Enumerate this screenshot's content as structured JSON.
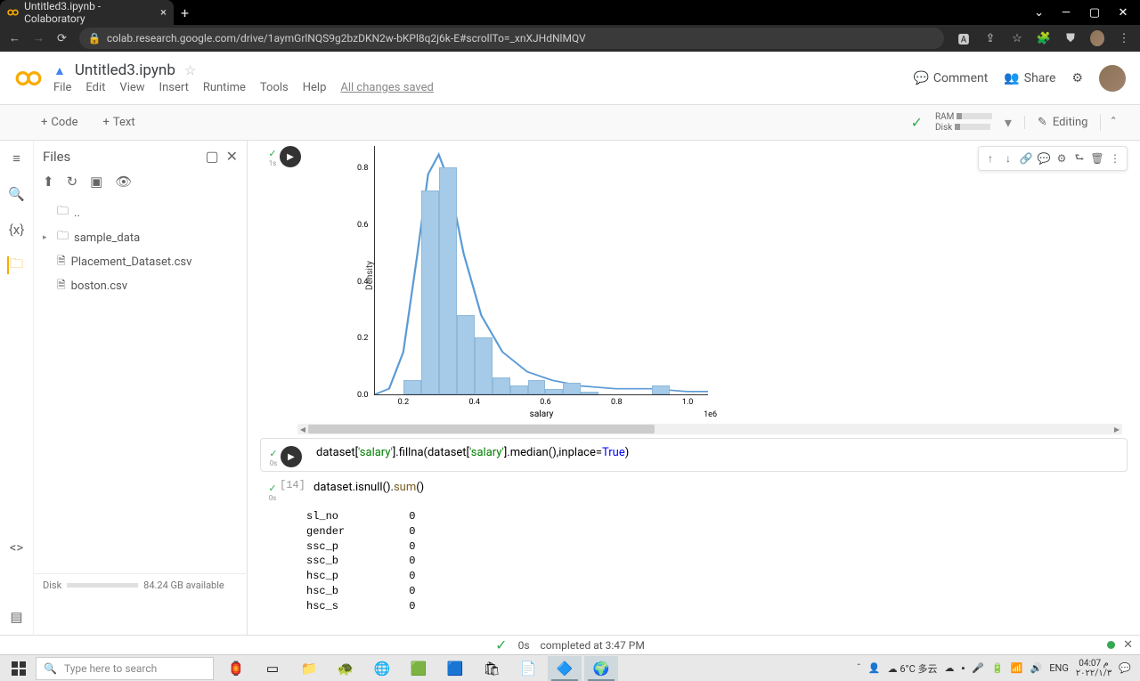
{
  "browser": {
    "tab_title": "Untitled3.ipynb - Colaboratory",
    "url": "colab.research.google.com/drive/1aymGrlNQS9g2bzDKN2w-bKPl8q2j6k-E#scrollTo=_xnXJHdNlMQV"
  },
  "colab": {
    "title": "Untitled3.ipynb",
    "menu": [
      "File",
      "Edit",
      "View",
      "Insert",
      "Runtime",
      "Tools",
      "Help"
    ],
    "saved_text": "All changes saved",
    "comment": "Comment",
    "share": "Share"
  },
  "toolbar": {
    "code": "Code",
    "text": "Text",
    "ram": "RAM",
    "disk": "Disk",
    "editing": "Editing"
  },
  "files": {
    "title": "Files",
    "dotdot": "..",
    "sample_data": "sample_data",
    "f1": "Placement_Dataset.csv",
    "f2": "boston.csv",
    "disk_label": "Disk",
    "disk_avail": "84.24 GB available"
  },
  "cells": {
    "c1_time": "1s",
    "c2_code_parts": {
      "p1": "dataset[",
      "p2": "'salary'",
      "p3": "].fillna(dataset[",
      "p4": "'salary'",
      "p5": "].median(),inplace=",
      "p6": "True",
      "p7": ")"
    },
    "c2_time": "0s",
    "c3_prompt": "[14]",
    "c3_code_parts": {
      "p1": "dataset.isnull().",
      "p2": "sum",
      "p3": "()"
    },
    "c3_time": "0s",
    "c3_output": "sl_no           0\ngender          0\nssc_p           0\nssc_b           0\nhsc_p           0\nhsc_b           0\nhsc_s           0"
  },
  "chart_data": {
    "type": "hist_kde",
    "xlabel": "salary",
    "ylabel": "Density",
    "sci": "1e6",
    "yticks": [
      0.0,
      0.2,
      0.4,
      0.6,
      0.8
    ],
    "xticks": [
      0.2,
      0.4,
      0.6,
      0.8,
      1.0
    ],
    "xlim": [
      0.12,
      1.06
    ],
    "ylim": [
      0.0,
      0.88
    ],
    "bars": [
      {
        "x": 0.2,
        "w": 0.05,
        "h": 0.05
      },
      {
        "x": 0.25,
        "w": 0.05,
        "h": 0.72
      },
      {
        "x": 0.3,
        "w": 0.05,
        "h": 0.8
      },
      {
        "x": 0.35,
        "w": 0.05,
        "h": 0.28
      },
      {
        "x": 0.4,
        "w": 0.05,
        "h": 0.2
      },
      {
        "x": 0.45,
        "w": 0.05,
        "h": 0.06
      },
      {
        "x": 0.5,
        "w": 0.05,
        "h": 0.03
      },
      {
        "x": 0.55,
        "w": 0.05,
        "h": 0.05
      },
      {
        "x": 0.6,
        "w": 0.05,
        "h": 0.02
      },
      {
        "x": 0.65,
        "w": 0.05,
        "h": 0.04
      },
      {
        "x": 0.7,
        "w": 0.05,
        "h": 0.01
      },
      {
        "x": 0.9,
        "w": 0.05,
        "h": 0.03
      }
    ],
    "kde": [
      [
        0.12,
        0.0
      ],
      [
        0.16,
        0.02
      ],
      [
        0.2,
        0.15
      ],
      [
        0.24,
        0.5
      ],
      [
        0.27,
        0.78
      ],
      [
        0.3,
        0.85
      ],
      [
        0.33,
        0.75
      ],
      [
        0.37,
        0.5
      ],
      [
        0.42,
        0.28
      ],
      [
        0.48,
        0.15
      ],
      [
        0.55,
        0.08
      ],
      [
        0.62,
        0.05
      ],
      [
        0.7,
        0.03
      ],
      [
        0.8,
        0.02
      ],
      [
        0.9,
        0.02
      ],
      [
        1.0,
        0.01
      ],
      [
        1.06,
        0.01
      ]
    ]
  },
  "status": {
    "time": "0s",
    "completed": "completed at 3:47 PM"
  },
  "taskbar": {
    "search_placeholder": "Type here to search",
    "weather": "6°C 多云",
    "lang": "ENG",
    "time": "04:07 م",
    "date": "٢٠٢٢/١/٣"
  }
}
